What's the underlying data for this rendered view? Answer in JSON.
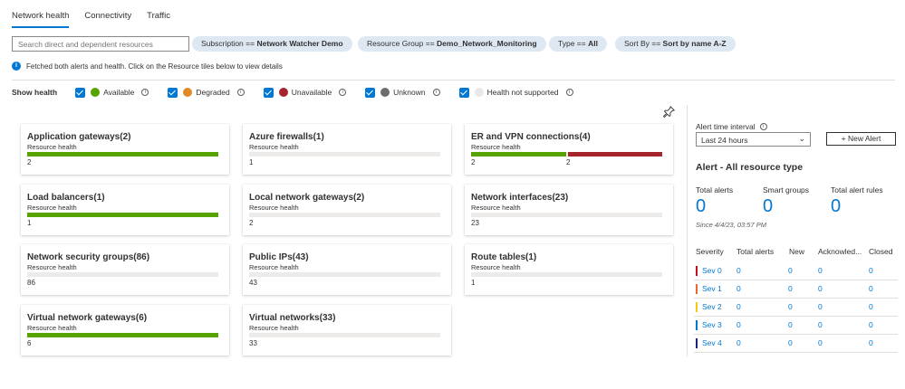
{
  "tabs": [
    "Network health",
    "Connectivity",
    "Traffic"
  ],
  "search": {
    "placeholder": "Search direct and dependent resources"
  },
  "filters": [
    {
      "key": "Subscription ==",
      "value": "Network Watcher Demo"
    },
    {
      "key": "Resource Group ==",
      "value": "Demo_Network_Monitoring"
    },
    {
      "key": "Type ==",
      "value": "All"
    },
    {
      "key": "Sort By ==",
      "value": "Sort by name A-Z"
    }
  ],
  "info_text": "Fetched both alerts and health. Click on the Resource tiles below to view details",
  "show_health": {
    "label": "Show health",
    "items": [
      {
        "label": "Available",
        "color": "#57a300"
      },
      {
        "label": "Degraded",
        "color": "#e08b25"
      },
      {
        "label": "Unavailable",
        "color": "#a4262c"
      },
      {
        "label": "Unknown",
        "color": "#6d6d6d"
      },
      {
        "label": "Health not supported",
        "color": "#e8e8e8"
      }
    ]
  },
  "tile_subtitle": "Resource health",
  "tiles": [
    {
      "title": "Application gateways(2)",
      "counts": [
        "2"
      ],
      "available": 1.0,
      "unavailable": 0
    },
    {
      "title": "Azure firewalls(1)",
      "counts": [
        "1"
      ],
      "available": 0,
      "unavailable": 0
    },
    {
      "title": "ER and VPN connections(4)",
      "counts": [
        "2",
        "2"
      ],
      "available": 0.5,
      "unavailable": 0.5
    },
    {
      "title": "Load balancers(1)",
      "counts": [
        "1"
      ],
      "available": 1.0,
      "unavailable": 0
    },
    {
      "title": "Local network gateways(2)",
      "counts": [
        "2"
      ],
      "available": 0,
      "unavailable": 0
    },
    {
      "title": "Network interfaces(23)",
      "counts": [
        "23"
      ],
      "available": 0,
      "unavailable": 0
    },
    {
      "title": "Network security groups(86)",
      "counts": [
        "86"
      ],
      "available": 0,
      "unavailable": 0
    },
    {
      "title": "Public IPs(43)",
      "counts": [
        "43"
      ],
      "available": 0,
      "unavailable": 0
    },
    {
      "title": "Route tables(1)",
      "counts": [
        "1"
      ],
      "available": 0,
      "unavailable": 0
    },
    {
      "title": "Virtual network gateways(6)",
      "counts": [
        "6"
      ],
      "available": 1.0,
      "unavailable": 0
    },
    {
      "title": "Virtual networks(33)",
      "counts": [
        "33"
      ],
      "available": 0,
      "unavailable": 0
    }
  ],
  "alerts": {
    "interval_label": "Alert time interval",
    "interval_value": "Last 24 hours",
    "new_alert_label": "+ New Alert",
    "heading": "Alert - All resource type",
    "stats": [
      {
        "label": "Total alerts",
        "value": "0"
      },
      {
        "label": "Smart groups",
        "value": "0"
      },
      {
        "label": "Total alert rules",
        "value": "0"
      }
    ],
    "since": "Since 4/4/23, 03:57 PM",
    "columns": [
      "Severity",
      "Total alerts",
      "New",
      "Acknowled...",
      "Closed"
    ],
    "rows": [
      {
        "sev": "Sev 0",
        "color": "#c50f1f",
        "total": "0",
        "new": "0",
        "ack": "0",
        "closed": "0"
      },
      {
        "sev": "Sev 1",
        "color": "#e8682e",
        "total": "0",
        "new": "0",
        "ack": "0",
        "closed": "0"
      },
      {
        "sev": "Sev 2",
        "color": "#f2c811",
        "total": "0",
        "new": "0",
        "ack": "0",
        "closed": "0"
      },
      {
        "sev": "Sev 3",
        "color": "#0078d4",
        "total": "0",
        "new": "0",
        "ack": "0",
        "closed": "0"
      },
      {
        "sev": "Sev 4",
        "color": "#1a237e",
        "total": "0",
        "new": "0",
        "ack": "0",
        "closed": "0"
      }
    ]
  }
}
